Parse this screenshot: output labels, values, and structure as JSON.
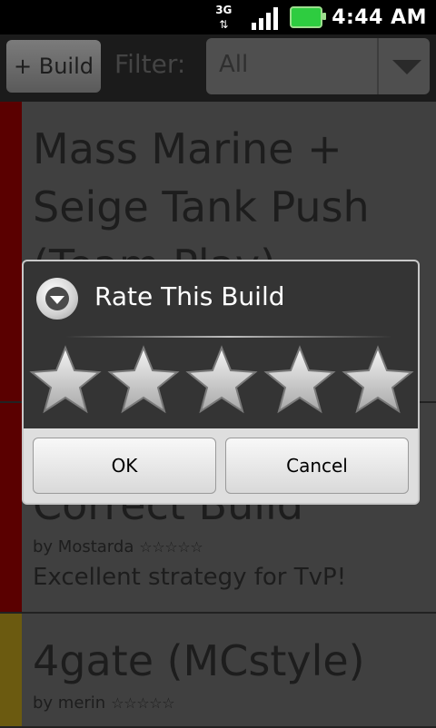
{
  "status_bar": {
    "network_label": "3G",
    "time": "4:44 AM",
    "icons": [
      "network-3g-icon",
      "signal-strength-icon",
      "battery-charging-icon"
    ]
  },
  "toolbar": {
    "add_build_label": "+ Build",
    "filter_label": "Filter:",
    "filter_value": "All"
  },
  "builds": [
    {
      "title": "Mass Marine + Seige Tank Push (Team Play)",
      "stripe_color": "#5a0000"
    },
    {
      "title": "Correct Build",
      "author": "by Mostarda",
      "rating_stars": 5,
      "description": "Excellent strategy for TvP!",
      "stripe_color": "#5a0000"
    },
    {
      "title": "4gate (MCstyle)",
      "author": "by merin",
      "rating_stars": 5,
      "stripe_color": "#6b5a10"
    }
  ],
  "dialog": {
    "title": "Rate This Build",
    "stars_total": 5,
    "ok_label": "OK",
    "cancel_label": "Cancel"
  }
}
